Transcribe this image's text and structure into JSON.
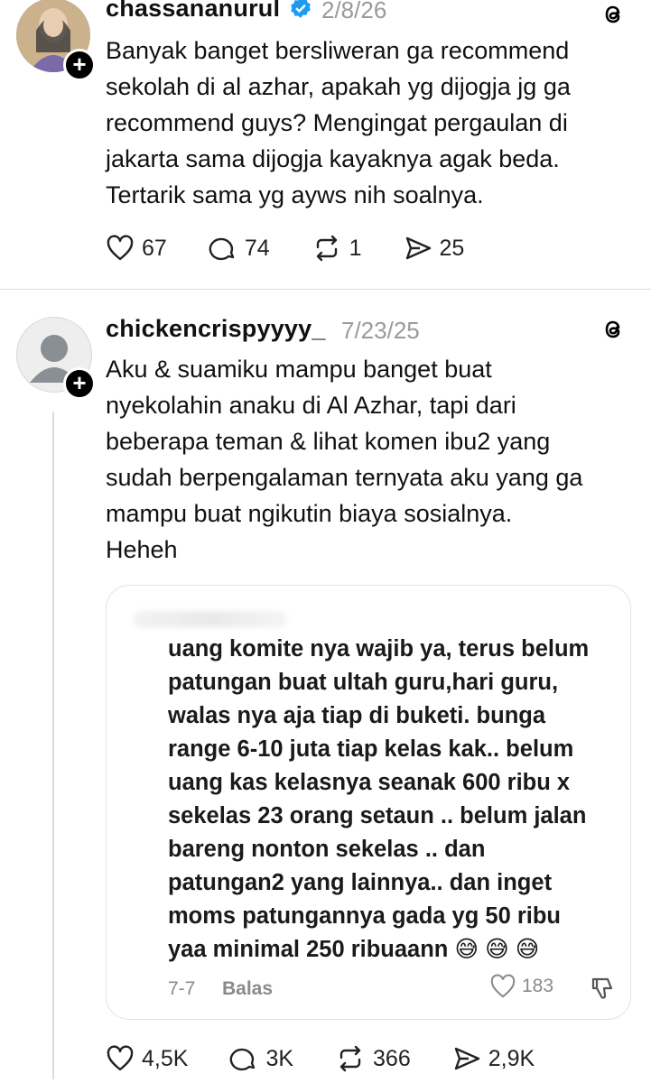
{
  "post1": {
    "username": "chassananurul",
    "date": "2/8/26",
    "text": "Banyak banget bersliweran ga recommend\nsekolah di al azhar, apakah yg dijogja jg ga\nrecommend guys? Mengingat pergaulan di\njakarta sama dijogja kayaknya agak beda.\nTertarik sama yg ayws nih soalnya.",
    "likes": "67",
    "replies": "74",
    "reposts": "1",
    "shares": "25"
  },
  "post2": {
    "username": "chickencrispyyyy_",
    "date": "7/23/25",
    "text": "Aku & suamiku mampu banget buat\nnyekolahin anaku di Al Azhar, tapi dari\nbeberapa teman & lihat komen ibu2 yang\nsudah berpengalaman ternyata aku yang ga\nmampu buat ngikutin biaya sosialnya.\nHeheh",
    "quote": {
      "text": "uang komite nya wajib ya, terus belum\npatungan buat ultah guru,hari guru,\nwalas nya aja tiap di buketi. bunga\nrange 6-10 juta tiap kelas kak.. belum\nuang kas kelasnya seanak 600 ribu x\nsekelas 23 orang setaun .. belum jalan\nbareng nonton sekelas .. dan\npatungan2 yang lainnya.. dan inget\nmoms patungannya gada yg 50 ribu\nyaa minimal 250 ribuaann 😅 😅 😅",
      "date": "7-7",
      "reply_label": "Balas",
      "likes": "183"
    },
    "likes": "4,5K",
    "replies": "3K",
    "reposts": "366",
    "shares": "2,9K"
  },
  "colors": {
    "verified": "#1d9bf0",
    "divider": "#dedede",
    "muted": "#9a9a9a"
  }
}
